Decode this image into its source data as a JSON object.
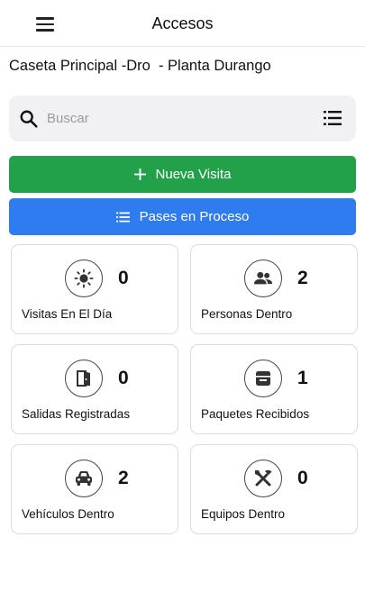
{
  "header": {
    "title": "Accesos",
    "menu_icon": "menu-icon"
  },
  "location": "Caseta Principal -Dro  - Planta Durango",
  "search": {
    "placeholder": "Buscar",
    "value": "",
    "icon": "search-icon",
    "filter_icon": "list-icon"
  },
  "actions": {
    "new_visit": {
      "label": "Nueva Visita",
      "icon": "plus-icon",
      "color": "#23a14a"
    },
    "passes": {
      "label": "Pases en Proceso",
      "icon": "list-icon",
      "color": "#2f7bf0"
    }
  },
  "stats": [
    {
      "label": "Visitas En El Día",
      "count": "0",
      "icon": "sun-icon"
    },
    {
      "label": "Personas Dentro",
      "count": "2",
      "icon": "people-icon"
    },
    {
      "label": "Salidas Registradas",
      "count": "0",
      "icon": "door-exit-icon"
    },
    {
      "label": "Paquetes Recibidos",
      "count": "1",
      "icon": "package-icon"
    },
    {
      "label": "Vehículos Dentro",
      "count": "2",
      "icon": "car-icon"
    },
    {
      "label": "Equipos Dentro",
      "count": "0",
      "icon": "tools-icon"
    }
  ]
}
